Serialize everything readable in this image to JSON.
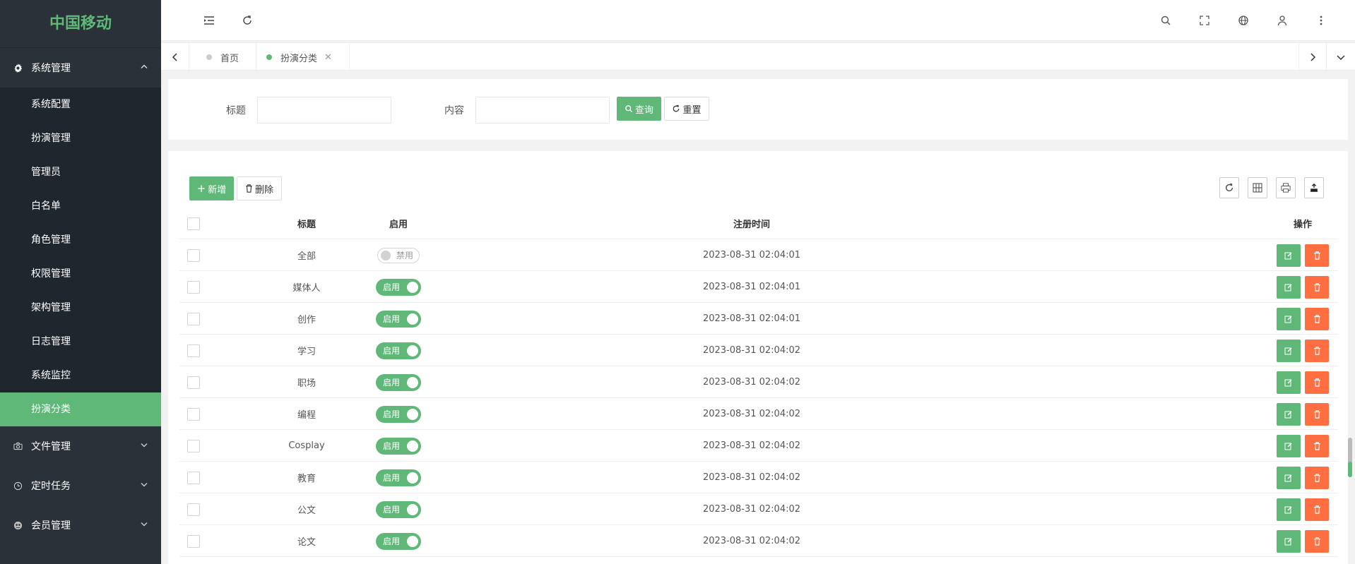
{
  "app": {
    "logo": "中国移动"
  },
  "sidebar": {
    "system_group": {
      "label": "系统管理",
      "icon": "gear-icon"
    },
    "system_items": [
      {
        "label": "系统配置"
      },
      {
        "label": "扮演管理"
      },
      {
        "label": "管理员"
      },
      {
        "label": "白名单"
      },
      {
        "label": "角色管理"
      },
      {
        "label": "权限管理"
      },
      {
        "label": "架构管理"
      },
      {
        "label": "日志管理"
      },
      {
        "label": "系统监控"
      },
      {
        "label": "扮演分类"
      }
    ],
    "active_item": "扮演分类",
    "groups": [
      {
        "label": "文件管理",
        "icon": "camera-icon"
      },
      {
        "label": "定时任务",
        "icon": "clock-icon"
      },
      {
        "label": "会员管理",
        "icon": "member-icon"
      }
    ]
  },
  "tabs": [
    {
      "label": "首页",
      "active": false
    },
    {
      "label": "扮演分类",
      "active": true,
      "close": "✕"
    }
  ],
  "search": {
    "title_label": "标题",
    "content_label": "内容",
    "title_value": "",
    "content_value": "",
    "query_button": "查询",
    "reset_button": "重置"
  },
  "toolbar": {
    "add_button": "新增",
    "delete_button": "删除"
  },
  "table": {
    "columns": [
      "标题",
      "启用",
      "注册时间",
      "操作"
    ],
    "rows": [
      {
        "title": "全部",
        "enabled": false,
        "status": "禁用",
        "time": "2023-08-31 02:04:01"
      },
      {
        "title": "媒体人",
        "enabled": true,
        "status": "启用",
        "time": "2023-08-31 02:04:01"
      },
      {
        "title": "创作",
        "enabled": true,
        "status": "启用",
        "time": "2023-08-31 02:04:01"
      },
      {
        "title": "学习",
        "enabled": true,
        "status": "启用",
        "time": "2023-08-31 02:04:02"
      },
      {
        "title": "职场",
        "enabled": true,
        "status": "启用",
        "time": "2023-08-31 02:04:02"
      },
      {
        "title": "编程",
        "enabled": true,
        "status": "启用",
        "time": "2023-08-31 02:04:02"
      },
      {
        "title": "Cosplay",
        "enabled": true,
        "status": "启用",
        "time": "2023-08-31 02:04:02"
      },
      {
        "title": "教育",
        "enabled": true,
        "status": "启用",
        "time": "2023-08-31 02:04:02"
      },
      {
        "title": "公文",
        "enabled": true,
        "status": "启用",
        "time": "2023-08-31 02:04:02"
      },
      {
        "title": "论文",
        "enabled": true,
        "status": "启用",
        "time": "2023-08-31 02:04:02"
      }
    ]
  },
  "colors": {
    "accent": "#5fb878",
    "sidebar_bg": "#2a3138",
    "submenu_bg": "#1f262d",
    "danger": "#ff5722"
  }
}
